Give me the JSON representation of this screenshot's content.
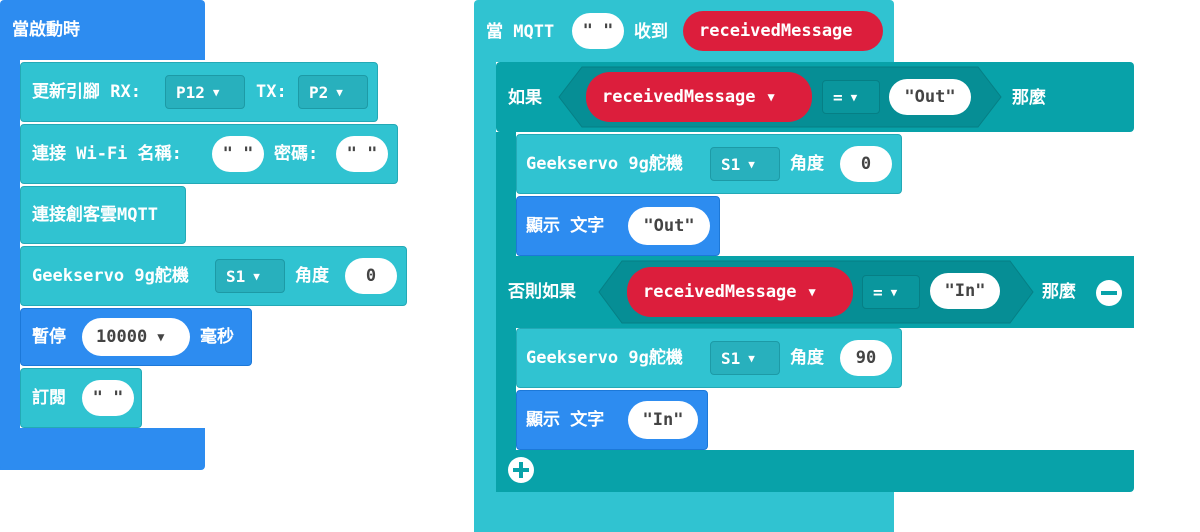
{
  "left_stack": {
    "on_start": "當啟動時",
    "update_pins": {
      "label": "更新引腳 RX:",
      "rx": "P12",
      "tx_label": "TX:",
      "tx": "P2"
    },
    "wifi": {
      "label": "連接 Wi-Fi 名稱:",
      "ssid": "\" \"",
      "pw_label": "密碼:",
      "pw": "\" \""
    },
    "connect_mqtt": "連接創客雲MQTT",
    "servo": {
      "label": "Geekservo 9g舵機",
      "port": "S1",
      "angle_label": "角度",
      "angle": "0"
    },
    "pause": {
      "label": "暫停",
      "value": "10000",
      "unit": "毫秒"
    },
    "subscribe": {
      "label": "訂閱",
      "topic": "\" \""
    }
  },
  "right_stack": {
    "header": {
      "when": "當 MQTT",
      "topic": "\" \"",
      "received": "收到",
      "var": "receivedMessage"
    },
    "if_block": {
      "label": "如果",
      "var": "receivedMessage",
      "op": "=",
      "value": "\"Out\"",
      "then": "那麼"
    },
    "servo1": {
      "label": "Geekservo 9g舵機",
      "port": "S1",
      "angle_label": "角度",
      "angle": "0"
    },
    "show1": {
      "label": "顯示 文字",
      "value": "\"Out\""
    },
    "elseif_block": {
      "label": "否則如果",
      "var": "receivedMessage",
      "op": "=",
      "value": "\"In\"",
      "then": "那麼"
    },
    "servo2": {
      "label": "Geekservo 9g舵機",
      "port": "S1",
      "angle_label": "角度",
      "angle": "90"
    },
    "show2": {
      "label": "顯示 文字",
      "value": "\"In\""
    }
  },
  "colors": {
    "cyan": "#30c3d1",
    "blue": "#2d8cf0",
    "teal": "#08a2a9",
    "red": "#dc1e3c"
  },
  "icons": [
    "dropdown-caret-icon",
    "remove-circle-icon",
    "add-circle-icon"
  ]
}
